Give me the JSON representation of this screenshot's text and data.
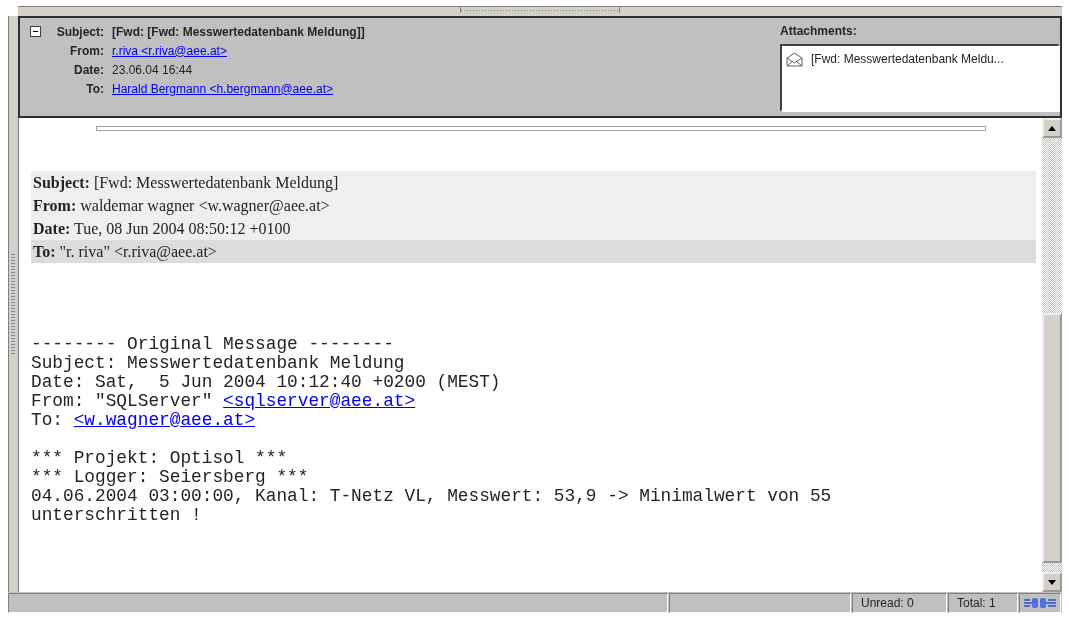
{
  "header": {
    "expanded": true,
    "rows": [
      {
        "label": "Subject:",
        "value": "[Fwd: [Fwd: Messwertedatenbank Meldung]]",
        "kind": "subject"
      },
      {
        "label": "From:",
        "value": "r.riva <r.riva@aee.at>",
        "kind": "link"
      },
      {
        "label": "Date:",
        "value": "23.06.04 16:44",
        "kind": "text"
      },
      {
        "label": "To:",
        "value": "Harald Bergmann <h.bergmann@aee.at>",
        "kind": "link"
      }
    ]
  },
  "attachments": {
    "title": "Attachments:",
    "items": [
      {
        "name": "[Fwd: Messwertedatenbank Meldu..."
      }
    ]
  },
  "forwarded_header": [
    {
      "label": "Subject:",
      "value": "[Fwd: Messwertedatenbank Meldung]",
      "highlighted": false
    },
    {
      "label": "From:",
      "value": "waldemar wagner <w.wagner@aee.at>",
      "highlighted": false
    },
    {
      "label": "Date:",
      "value": "Tue, 08 Jun 2004 08:50:12 +0100",
      "highlighted": false
    },
    {
      "label": "To:",
      "value": "\"r. riva\" <r.riva@aee.at>",
      "highlighted": true
    }
  ],
  "body": [
    [
      {
        "text": "-------- Original Message --------"
      },
      {
        "text": "Subject: Messwertedatenbank Meldung"
      },
      {
        "text": "Date: Sat,  5 Jun 2004 10:12:40 +0200 (MEST)"
      },
      {
        "text": "From: \"SQLServer\" ",
        "link": "<sqlserver@aee.at>"
      },
      {
        "text": "To: ",
        "link": "<w.wagner@aee.at>"
      }
    ],
    [
      {
        "text": "*** Projekt: Optisol ***"
      },
      {
        "text": "*** Logger: Seiersberg ***"
      },
      {
        "text": "04.06.2004 03:00:00, Kanal: T-Netz VL, Messwert: 53,9 -> Minimalwert von 55"
      },
      {
        "text": "unterschritten !"
      }
    ]
  ],
  "status_bar": {
    "unread": "Unread: 0",
    "total": "Total: 1"
  }
}
